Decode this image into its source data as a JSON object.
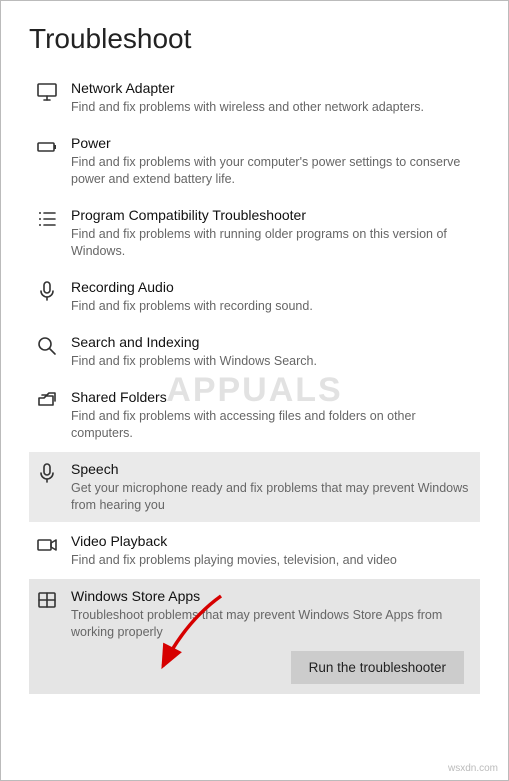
{
  "title": "Troubleshoot",
  "items": [
    {
      "icon": "monitor",
      "title": "Network Adapter",
      "desc": "Find and fix problems with wireless and other network adapters.",
      "selected": false
    },
    {
      "icon": "battery",
      "title": "Power",
      "desc": "Find and fix problems with your computer's power settings to conserve power and extend battery life.",
      "selected": false
    },
    {
      "icon": "list",
      "title": "Program Compatibility Troubleshooter",
      "desc": "Find and fix problems with running older programs on this version of Windows.",
      "selected": false
    },
    {
      "icon": "mic",
      "title": "Recording Audio",
      "desc": "Find and fix problems with recording sound.",
      "selected": false
    },
    {
      "icon": "search",
      "title": "Search and Indexing",
      "desc": "Find and fix problems with Windows Search.",
      "selected": false
    },
    {
      "icon": "folders",
      "title": "Shared Folders",
      "desc": "Find and fix problems with accessing files and folders on other computers.",
      "selected": false
    },
    {
      "icon": "mic",
      "title": "Speech",
      "desc": "Get your microphone ready and fix problems that may prevent Windows from hearing you",
      "selected": "highlight"
    },
    {
      "icon": "video",
      "title": "Video Playback",
      "desc": "Find and fix problems playing movies, television, and video",
      "selected": false
    },
    {
      "icon": "store",
      "title": "Windows Store Apps",
      "desc": "Troubleshoot problems that may prevent Windows Store Apps from working properly",
      "selected": true
    }
  ],
  "button_label": "Run the troubleshooter",
  "watermark": "APPUALS",
  "footer": "wsxdn.com"
}
